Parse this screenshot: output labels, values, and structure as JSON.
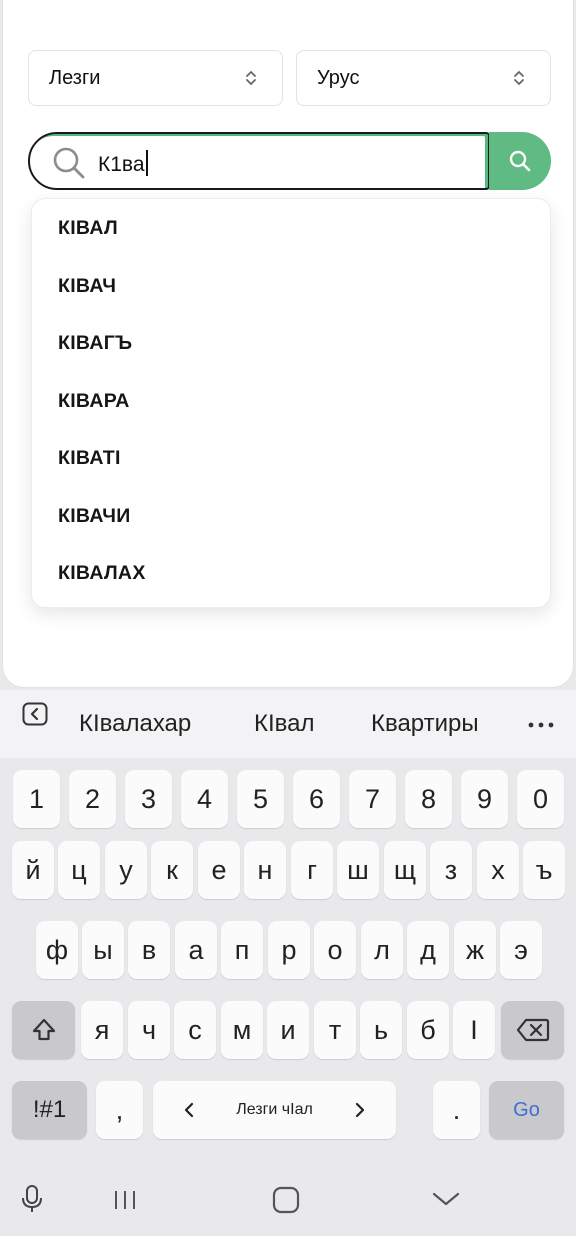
{
  "app": {
    "source_language": "Лезги",
    "target_language": "Урус",
    "search": {
      "value": "К1ва"
    },
    "suggestions": [
      "КIВАЛ",
      "КIВАЧ",
      "КIВАГЪ",
      "КIВАРА",
      "КIВАТI",
      "КIВАЧИ",
      "КIВАЛАХ"
    ]
  },
  "keyboard": {
    "predictions": [
      "КIвалахар",
      "КIвал",
      "Квартиры"
    ],
    "row_digits": [
      "1",
      "2",
      "3",
      "4",
      "5",
      "6",
      "7",
      "8",
      "9",
      "0"
    ],
    "row1": [
      "й",
      "ц",
      "у",
      "к",
      "е",
      "н",
      "г",
      "ш",
      "щ",
      "з",
      "х",
      "ъ"
    ],
    "row2": [
      "ф",
      "ы",
      "в",
      "а",
      "п",
      "р",
      "о",
      "л",
      "д",
      "ж",
      "э"
    ],
    "row3": [
      "я",
      "ч",
      "с",
      "м",
      "и",
      "т",
      "ь",
      "б",
      "I"
    ],
    "symbols_label": "!#1",
    "comma": ",",
    "space_label": "Лезги чIал",
    "period": ".",
    "go_label": "Go"
  },
  "colors": {
    "accent_green": "#5fba84",
    "go_blue": "#3f6fd1"
  },
  "icons": [
    "chevron-updown-icon",
    "search-icon",
    "back-icon",
    "more-icon",
    "shift-icon",
    "backspace-icon",
    "mic-icon",
    "recents-icon",
    "home-icon",
    "down-chevron-icon"
  ]
}
